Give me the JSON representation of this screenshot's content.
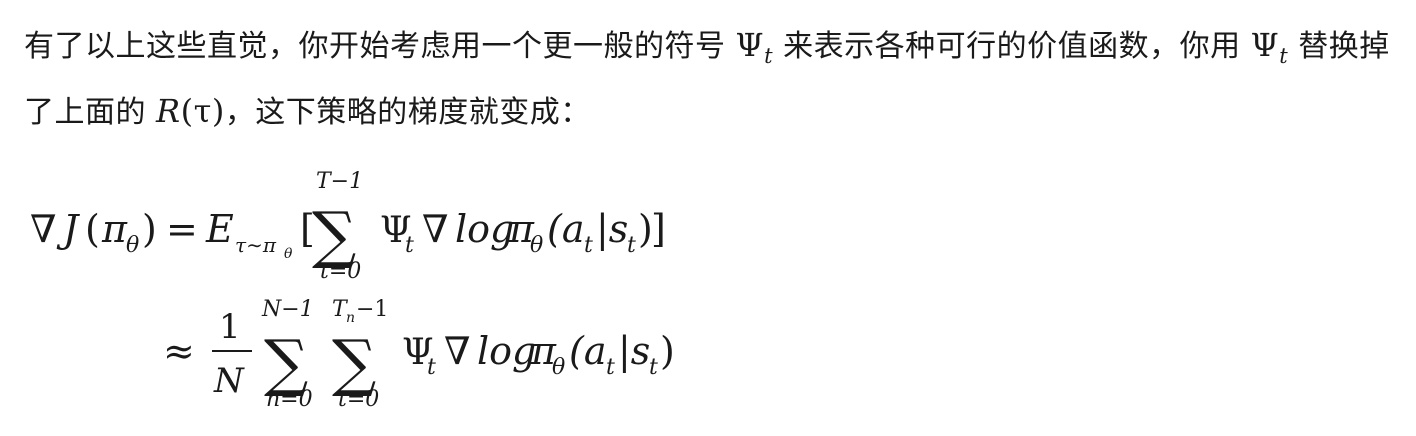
{
  "paragraph": {
    "part1": "有了以上这些直觉，你开始考虑用一个更一般的符号 ",
    "psi1": "Ψ",
    "psi1_sub": "t",
    "part2": " 来表示各种可行的价值函数，你用 ",
    "psi2": "Ψ",
    "psi2_sub": "t",
    "part3": " 替换掉了上面的 ",
    "r_symbol": "R",
    "r_arg": "(τ)",
    "part4": "，这下策略的梯度就变成："
  },
  "equation": {
    "line1": {
      "lhs_nabla": "∇",
      "lhs_J": "J",
      "lhs_paren_open": "(",
      "lhs_pi": "π",
      "lhs_pi_sub": "θ",
      "lhs_paren_close": ")",
      "equals": "=",
      "E": "E",
      "E_sub": "τ∼π",
      "E_sub_theta": "θ",
      "bracket_open": "[",
      "sum_symbol": "∑",
      "sum_upper": "T−1",
      "sum_lower": "t=0",
      "psi": "Ψ",
      "psi_sub": "t",
      "nabla": "∇",
      "log": "log",
      "pi": "π",
      "pi_sub": "θ",
      "arg": "(a",
      "arg_a_sub": "t",
      "bar": "|s",
      "arg_s_sub": "t",
      "arg_close": ")",
      "bracket_close": "]"
    },
    "line2": {
      "approx": "≈",
      "frac_num": "1",
      "frac_den": "N",
      "sum1_symbol": "∑",
      "sum1_upper": "N−1",
      "sum1_lower": "n=0",
      "sum2_symbol": "∑",
      "sum2_upper_T": "T",
      "sum2_upper_n": "n",
      "sum2_upper_rest": "−1",
      "sum2_lower": "t=0",
      "psi": "Ψ",
      "psi_sub": "t",
      "nabla": "∇",
      "log": "log",
      "pi": "π",
      "pi_sub": "θ",
      "arg": "(a",
      "arg_a_sub": "t",
      "bar": "|s",
      "arg_s_sub": "t",
      "arg_close": ")"
    }
  }
}
